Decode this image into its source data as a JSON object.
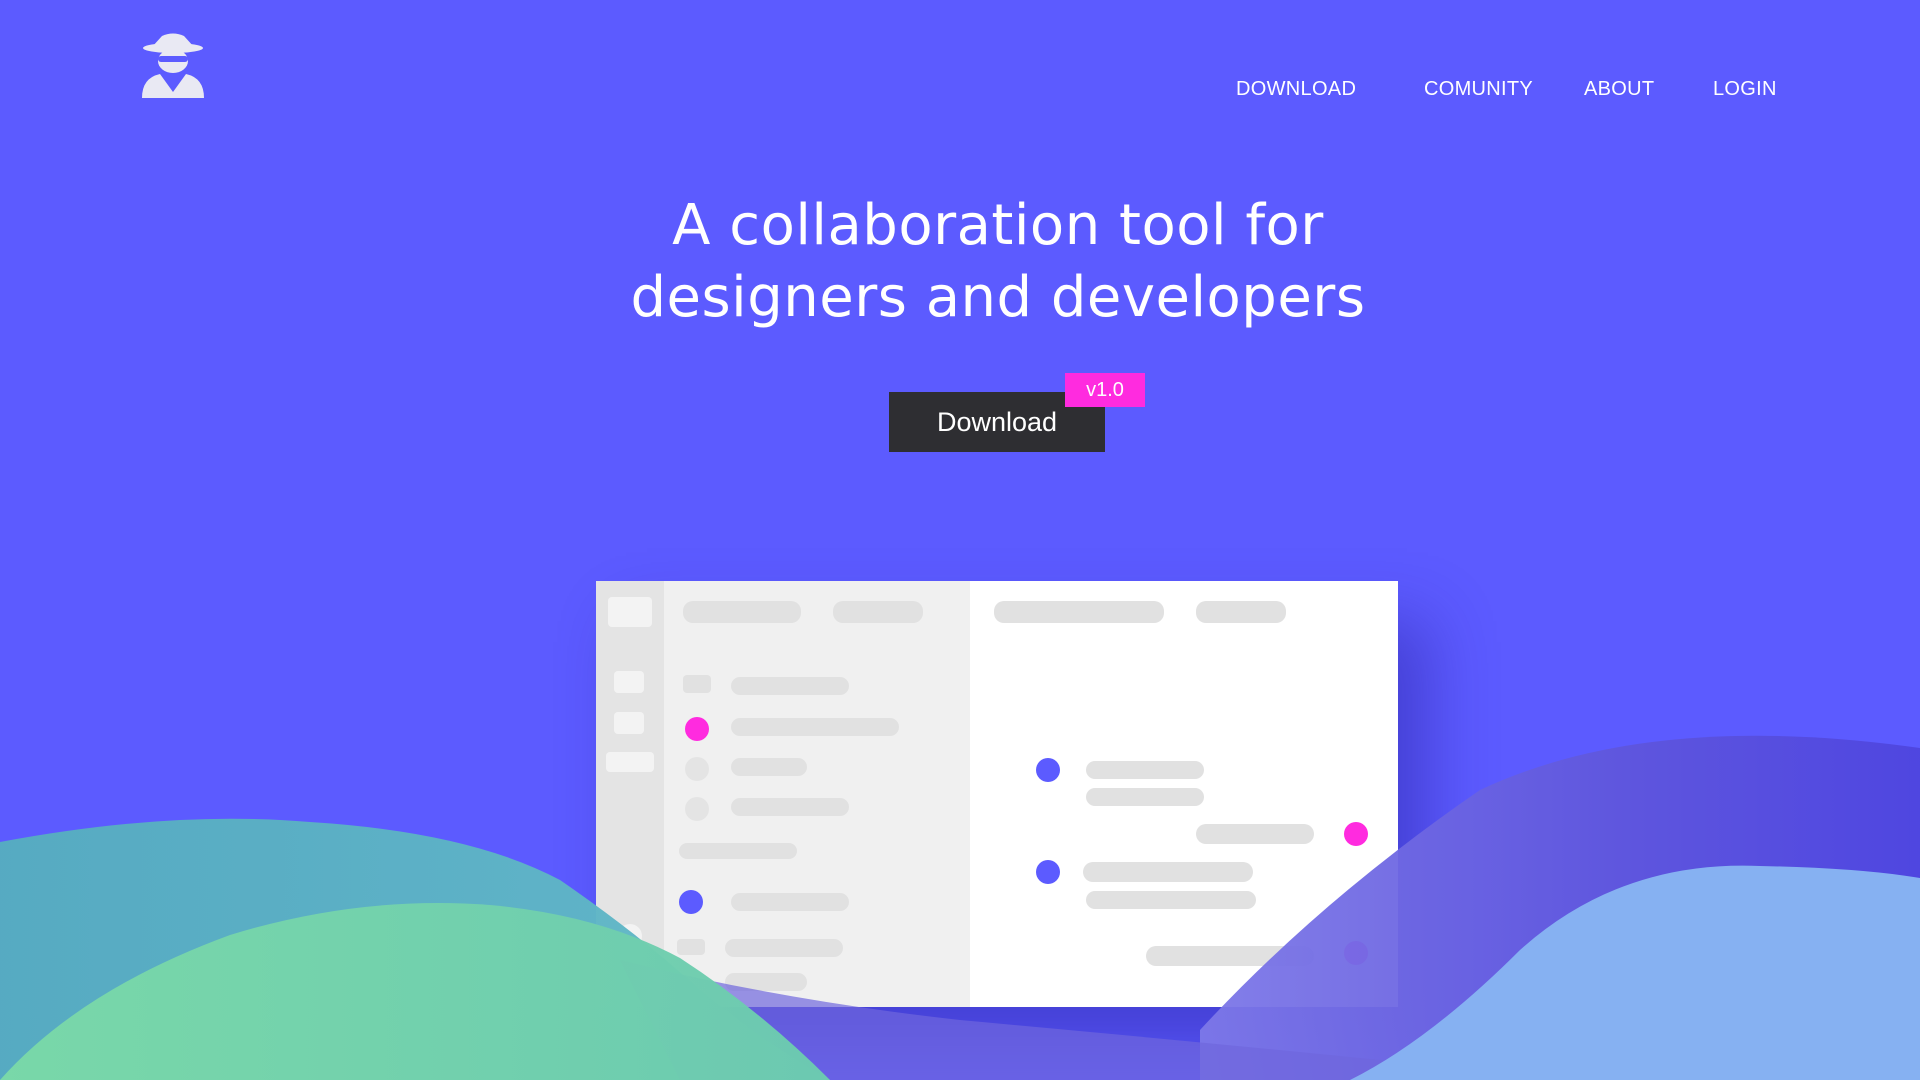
{
  "brand": {
    "logo_icon": "spy-agent-icon"
  },
  "nav": {
    "items": [
      {
        "label": "DOWNLOAD"
      },
      {
        "label": "COMUNITY"
      },
      {
        "label": "ABOUT"
      },
      {
        "label": "LOGIN"
      }
    ]
  },
  "hero": {
    "headline_line1": "A collaboration tool for",
    "headline_line2": "designers and developers",
    "download_label": "Download",
    "version_badge": "v1.0"
  },
  "colors": {
    "background": "#5c5bff",
    "button": "#2e2e32",
    "badge": "#ff2bdf",
    "accent_blue": "#5c5bff",
    "wave_green": "#7ad9a8",
    "wave_teal": "#56adc0",
    "wave_light_blue": "#86b1f2"
  }
}
